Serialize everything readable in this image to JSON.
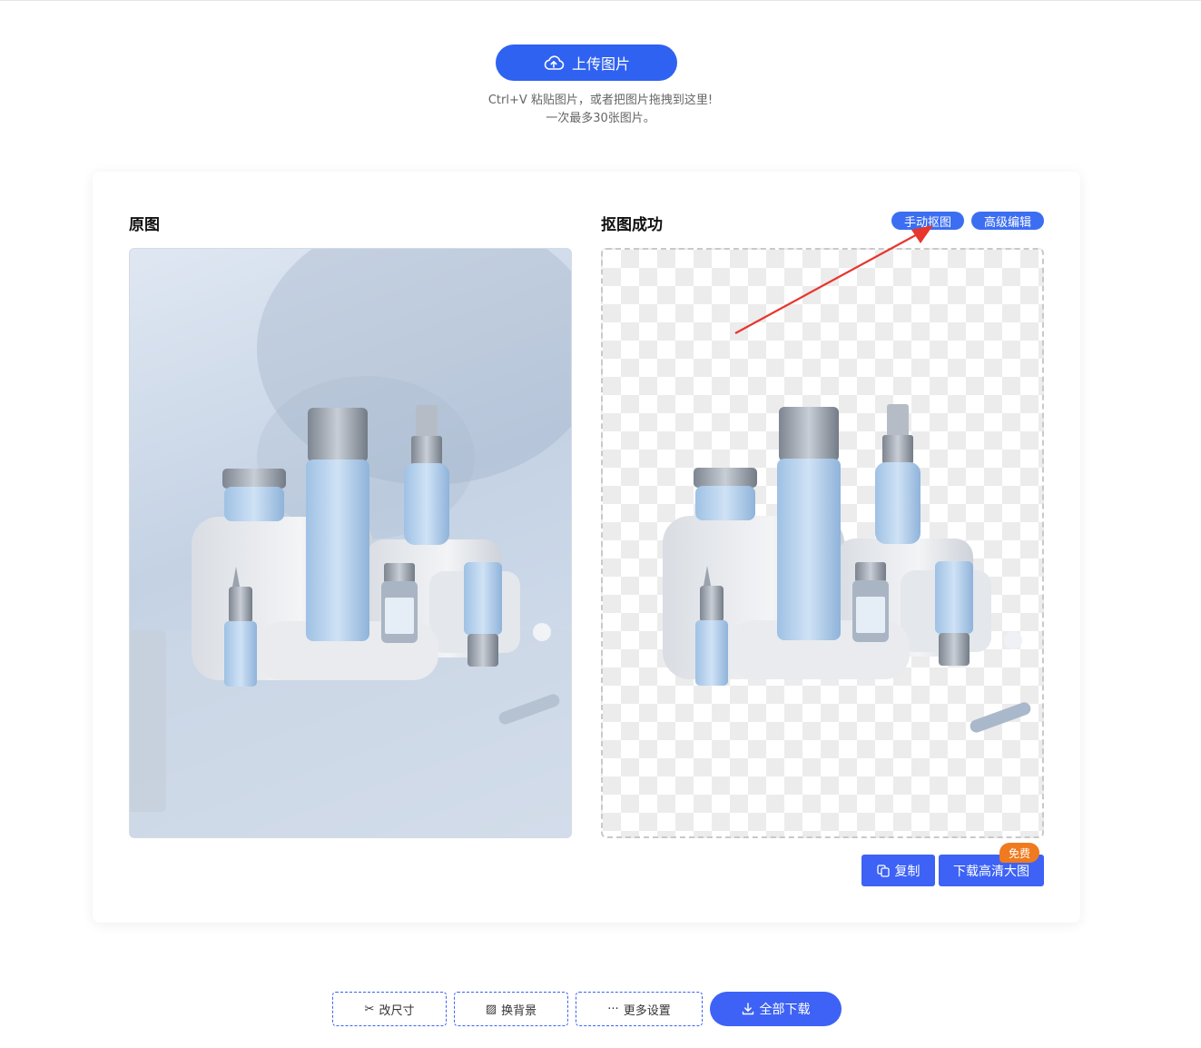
{
  "upload": {
    "label": "上传图片",
    "hint_line1": "Ctrl+V 粘贴图片，或者把图片拖拽到这里!",
    "hint_line2": "一次最多30张图片。"
  },
  "original": {
    "title": "原图"
  },
  "result": {
    "title": "抠图成功",
    "manual_label": "手动抠图",
    "advanced_label": "高级编辑",
    "copy_label": "复制",
    "download_label": "下载高清大图",
    "free_badge": "免费"
  },
  "toolbar": {
    "resize_icon": "✂",
    "resize_label": "改尺寸",
    "background_icon": "▨",
    "background_label": "换背景",
    "more_icon": "···",
    "more_label": "更多设置",
    "download_all_label": "全部下载"
  },
  "colors": {
    "primary": "#2f62f0",
    "badge": "#f07a1f",
    "arrow": "#e8352e"
  }
}
